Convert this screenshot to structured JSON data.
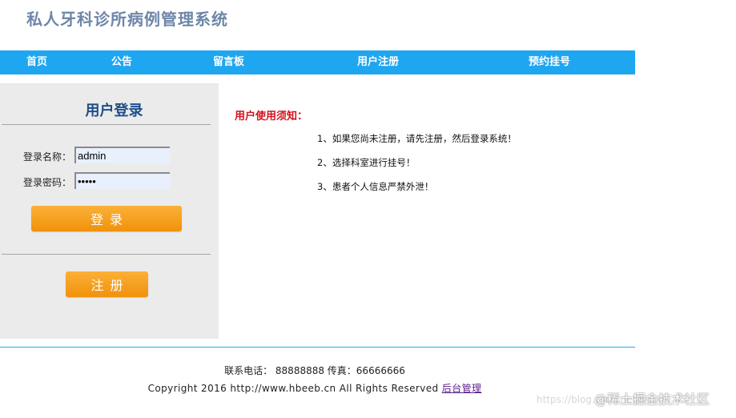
{
  "header": {
    "title": "私人牙科诊所病例管理系统"
  },
  "nav": {
    "items": [
      "首页",
      "公告",
      "留言板",
      "用户注册",
      "预约挂号"
    ]
  },
  "login": {
    "title": "用户登录",
    "username_label": "登录名称：",
    "username_value": "admin",
    "password_label": "登录密码：",
    "password_value": "admin",
    "login_button": "登录",
    "register_button": "注册"
  },
  "notice": {
    "title": "用户使用须知：",
    "items": [
      "1、如果您尚未注册，请先注册，然后登录系统！",
      "2、选择科室进行挂号！",
      "3、患者个人信息严禁外泄！"
    ]
  },
  "footer": {
    "contact": "联系电话： 88888888 传真：66666666",
    "copyright": "Copyright 2016 http://www.hbeeb.cn All Rights Reserved",
    "admin_link": "后台管理"
  },
  "watermarks": {
    "blog": "https://blog.csdn.net/weixin_45",
    "juejin": "@稀土掘金技术社区"
  },
  "colors": {
    "nav_bg": "#1ea6f0",
    "sidebar_bg": "#ebebeb",
    "button_orange": "#f7a11f",
    "notice_red": "#d4101c",
    "title_blue": "#1d4f8a"
  }
}
